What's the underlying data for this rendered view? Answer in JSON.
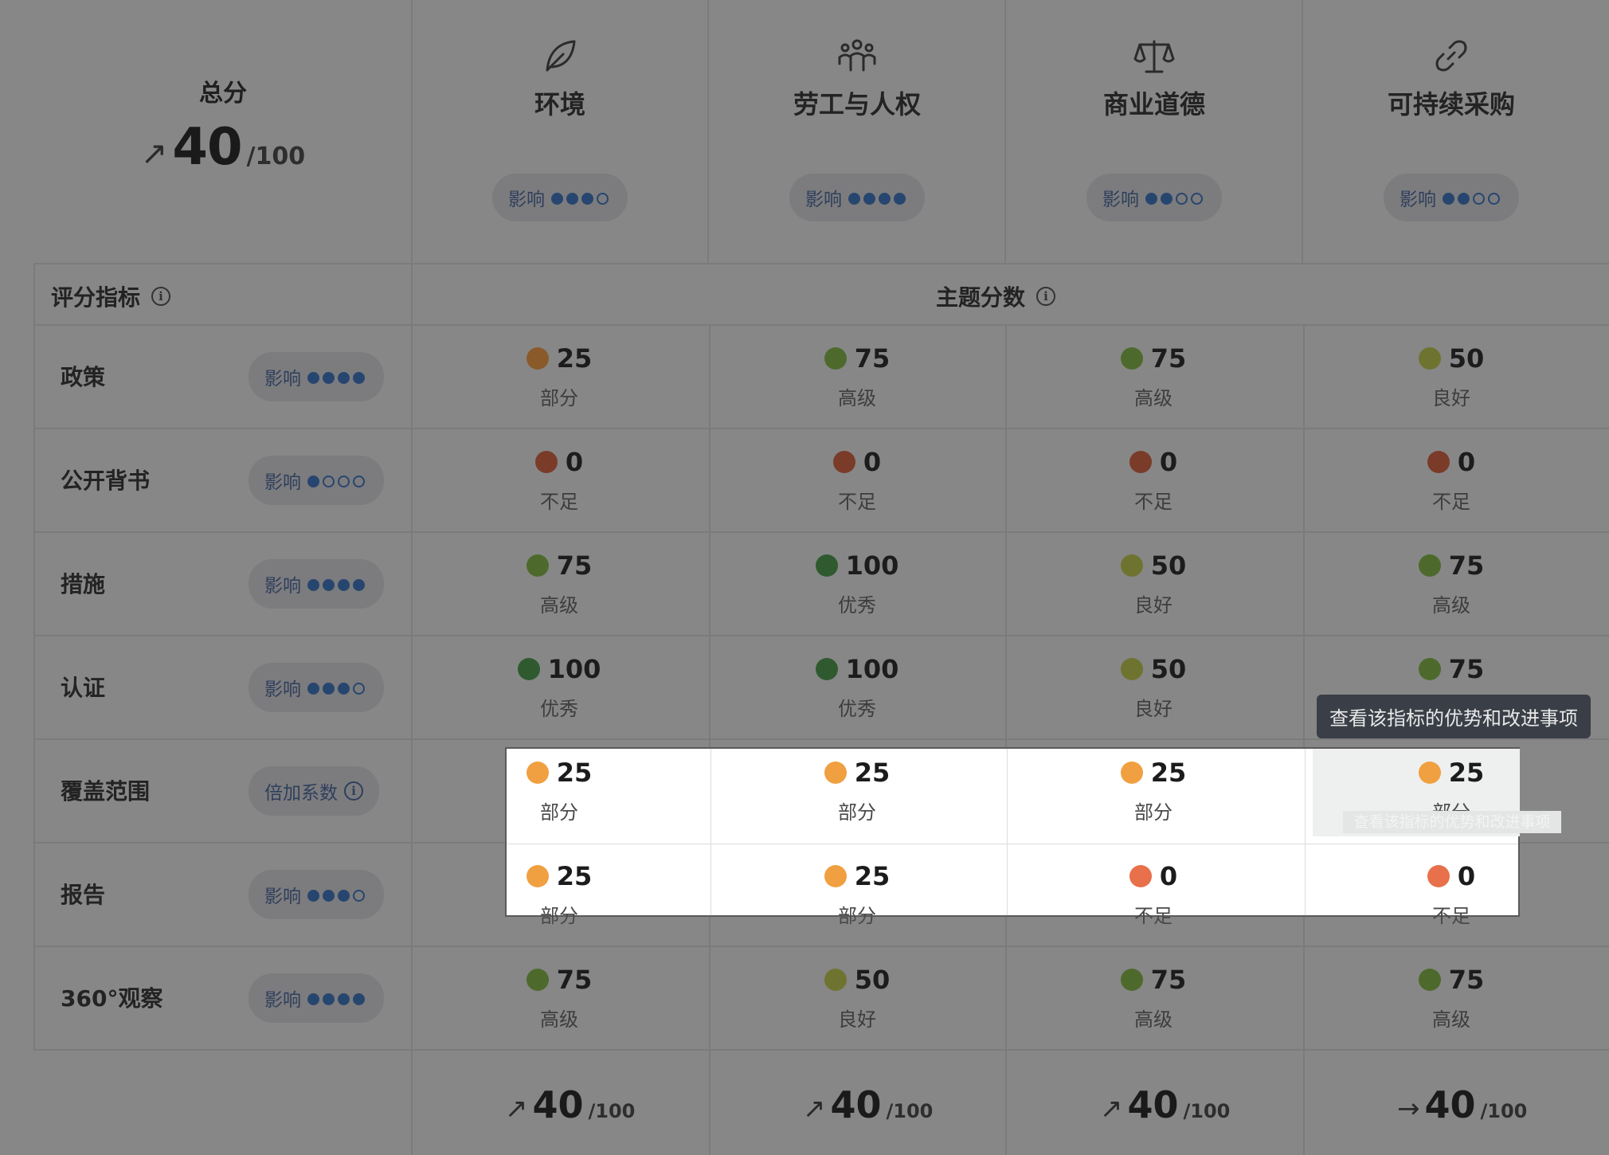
{
  "overall": {
    "label": "总分",
    "score": "40",
    "max": "/100",
    "trend": "↗"
  },
  "themes": [
    {
      "name": "环境",
      "icon": "leaf-icon",
      "impact_label": "影响",
      "impact": 3
    },
    {
      "name": "劳工与人权",
      "icon": "people-icon",
      "impact_label": "影响",
      "impact": 4
    },
    {
      "name": "商业道德",
      "icon": "scale-icon",
      "impact_label": "影响",
      "impact": 2
    },
    {
      "name": "可持续采购",
      "icon": "link-icon",
      "impact_label": "影响",
      "impact": 2
    }
  ],
  "headers": {
    "metrics": "评分指标",
    "theme_scores": "主题分数"
  },
  "metrics": [
    {
      "name": "政策",
      "badge": "影响",
      "impact": 4,
      "multiplier": false
    },
    {
      "name": "公开背书",
      "badge": "影响",
      "impact": 1,
      "multiplier": false
    },
    {
      "name": "措施",
      "badge": "影响",
      "impact": 4,
      "multiplier": false
    },
    {
      "name": "认证",
      "badge": "影响",
      "impact": 3,
      "multiplier": false
    },
    {
      "name": "覆盖范围",
      "badge": "倍加系数",
      "impact": 0,
      "multiplier": true
    },
    {
      "name": "报告",
      "badge": "影响",
      "impact": 3,
      "multiplier": false
    },
    {
      "name": "360°观察",
      "badge": "影响",
      "impact": 4,
      "multiplier": false
    }
  ],
  "scores": [
    [
      {
        "v": "25",
        "l": "部分",
        "c": "#8a5a2a"
      },
      {
        "v": "75",
        "l": "高级",
        "c": "#4d6a2c"
      },
      {
        "v": "75",
        "l": "高级",
        "c": "#4d6a2c"
      },
      {
        "v": "50",
        "l": "良好",
        "c": "#6e7430"
      }
    ],
    [
      {
        "v": "0",
        "l": "不足",
        "c": "#7a3b28"
      },
      {
        "v": "0",
        "l": "不足",
        "c": "#7a3b28"
      },
      {
        "v": "0",
        "l": "不足",
        "c": "#7a3b28"
      },
      {
        "v": "0",
        "l": "不足",
        "c": "#7a3b28"
      }
    ],
    [
      {
        "v": "75",
        "l": "高级",
        "c": "#4d6a2c"
      },
      {
        "v": "100",
        "l": "优秀",
        "c": "#2f5a30"
      },
      {
        "v": "50",
        "l": "良好",
        "c": "#6e7430"
      },
      {
        "v": "75",
        "l": "高级",
        "c": "#4d6a2c"
      }
    ],
    [
      {
        "v": "100",
        "l": "优秀",
        "c": "#2f5a30"
      },
      {
        "v": "100",
        "l": "优秀",
        "c": "#2f5a30"
      },
      {
        "v": "50",
        "l": "良好",
        "c": "#6e7430"
      },
      {
        "v": "75",
        "l": "",
        "c": "#4d6a2c"
      }
    ],
    [
      {
        "v": "25",
        "l": "部分",
        "c": "#f0a040"
      },
      {
        "v": "25",
        "l": "部分",
        "c": "#f0a040"
      },
      {
        "v": "25",
        "l": "部分",
        "c": "#f0a040"
      },
      {
        "v": "25",
        "l": "部分",
        "c": "#f0a040"
      }
    ],
    [
      {
        "v": "25",
        "l": "部分",
        "c": "#f0a040"
      },
      {
        "v": "25",
        "l": "部分",
        "c": "#f0a040"
      },
      {
        "v": "0",
        "l": "不足",
        "c": "#e8704a"
      },
      {
        "v": "0",
        "l": "不足",
        "c": "#e8704a"
      }
    ],
    [
      {
        "v": "75",
        "l": "高级",
        "c": "#4d6a2c"
      },
      {
        "v": "50",
        "l": "良好",
        "c": "#6e7430"
      },
      {
        "v": "75",
        "l": "高级",
        "c": "#4d6a2c"
      },
      {
        "v": "75",
        "l": "高级",
        "c": "#4d6a2c"
      }
    ]
  ],
  "tooltip": "查看该指标的优势和改进事项",
  "faded_tooltip": "查看该指标的优势和改进事项",
  "bottom_scores": [
    {
      "arrow": "↗",
      "score": "40",
      "max": "/100"
    },
    {
      "arrow": "↗",
      "score": "40",
      "max": "/100"
    },
    {
      "arrow": "↗",
      "score": "40",
      "max": "/100"
    },
    {
      "arrow": "→",
      "score": "40",
      "max": "/100"
    }
  ]
}
